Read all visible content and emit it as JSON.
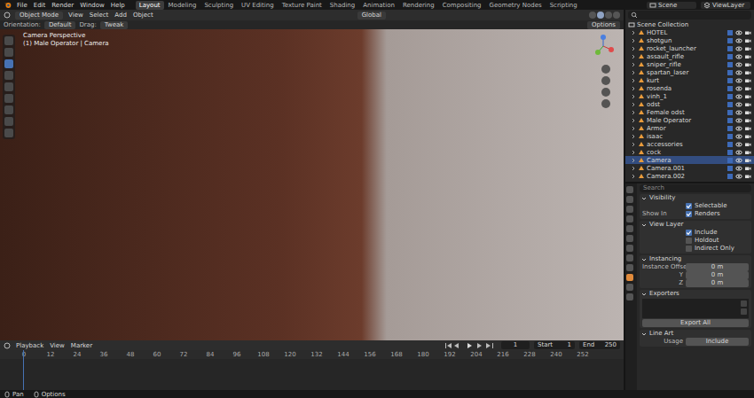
{
  "topbar": {
    "menus": [
      "File",
      "Edit",
      "Render",
      "Window",
      "Help"
    ],
    "workspaces": [
      {
        "label": "Layout",
        "selected": true
      },
      {
        "label": "Modeling",
        "selected": false
      },
      {
        "label": "Sculpting",
        "selected": false
      },
      {
        "label": "UV Editing",
        "selected": false
      },
      {
        "label": "Texture Paint",
        "selected": false
      },
      {
        "label": "Shading",
        "selected": false
      },
      {
        "label": "Animation",
        "selected": false
      },
      {
        "label": "Rendering",
        "selected": false
      },
      {
        "label": "Compositing",
        "selected": false
      },
      {
        "label": "Geometry Nodes",
        "selected": false
      },
      {
        "label": "Scripting",
        "selected": false
      }
    ],
    "scene": "Scene",
    "view_layer": "ViewLayer"
  },
  "viewport_header": {
    "mode": "Object Mode",
    "menus": [
      "View",
      "Select",
      "Add",
      "Object"
    ],
    "transform": "Global"
  },
  "tool_settings": {
    "orientation_label": "Orientation:",
    "orientation": "Default",
    "drag_label": "Drag:",
    "drag": "Tweak",
    "options": "Options"
  },
  "viewport": {
    "title": "Camera Perspective",
    "subtitle": "(1) Male Operator | Camera"
  },
  "timeline": {
    "menus": [
      "Playback",
      "View",
      "Marker"
    ],
    "current_frame": "1",
    "start_label": "Start",
    "start": "1",
    "end_label": "End",
    "end": "250",
    "ticks": [
      "0",
      "12",
      "24",
      "36",
      "48",
      "60",
      "72",
      "84",
      "96",
      "108",
      "120",
      "132",
      "144",
      "156",
      "168",
      "180",
      "192",
      "204",
      "216",
      "228",
      "240",
      "252"
    ]
  },
  "outliner": {
    "root": "Scene Collection",
    "items": [
      {
        "name": "HOTEL",
        "selected": false,
        "visible": true
      },
      {
        "name": "shotgun",
        "selected": false,
        "visible": true
      },
      {
        "name": "rocket_launcher",
        "selected": false,
        "visible": true
      },
      {
        "name": "assault_rifle",
        "selected": false,
        "visible": true
      },
      {
        "name": "sniper_rifle",
        "selected": false,
        "visible": true
      },
      {
        "name": "spartan_laser",
        "selected": false,
        "visible": true
      },
      {
        "name": "kurt",
        "selected": false,
        "visible": true
      },
      {
        "name": "rosenda",
        "selected": false,
        "visible": true
      },
      {
        "name": "vinh_1",
        "selected": false,
        "visible": true
      },
      {
        "name": "odst",
        "selected": false,
        "visible": true
      },
      {
        "name": "Female odst",
        "selected": false,
        "visible": true
      },
      {
        "name": "Male Operator",
        "selected": false,
        "visible": true
      },
      {
        "name": "Armor",
        "selected": false,
        "visible": true
      },
      {
        "name": "isaac",
        "selected": false,
        "visible": true
      },
      {
        "name": "accessories",
        "selected": false,
        "visible": true
      },
      {
        "name": "cock",
        "selected": false,
        "visible": true
      },
      {
        "name": "Camera",
        "selected": true,
        "visible": true
      },
      {
        "name": "Camera.001",
        "selected": false,
        "visible": true
      },
      {
        "name": "Camera.002",
        "selected": false,
        "visible": true
      }
    ]
  },
  "properties": {
    "search": {
      "placeholder": "Search"
    },
    "sections": [
      {
        "title": "Visibility",
        "rows": [
          {
            "kind": "checkbox",
            "prefix": "",
            "label": "Selectable",
            "checked": true
          },
          {
            "kind": "checkbox",
            "prefix": "Show In",
            "label": "Renders",
            "checked": true
          }
        ]
      },
      {
        "title": "View Layer",
        "rows": [
          {
            "kind": "checkbox",
            "prefix": "",
            "label": "Include",
            "checked": true
          },
          {
            "kind": "checkbox",
            "prefix": "",
            "label": "Holdout",
            "checked": false
          },
          {
            "kind": "checkbox",
            "prefix": "",
            "label": "Indirect Only",
            "checked": false
          }
        ]
      },
      {
        "title": "Instancing",
        "rows": [
          {
            "kind": "field",
            "label": "Instance Offset X",
            "value": "0 m"
          },
          {
            "kind": "field",
            "label": "Y",
            "value": "0 m"
          },
          {
            "kind": "field",
            "label": "Z",
            "value": "0 m"
          }
        ]
      },
      {
        "title": "Exporters",
        "rows": [
          {
            "kind": "list"
          },
          {
            "kind": "button",
            "label": "Export All"
          }
        ]
      },
      {
        "title": "Line Art",
        "rows": [
          {
            "kind": "field",
            "label": "Usage",
            "value": "Include"
          }
        ]
      }
    ]
  },
  "status_bar": {
    "items": [
      "Pan",
      "Options"
    ]
  }
}
